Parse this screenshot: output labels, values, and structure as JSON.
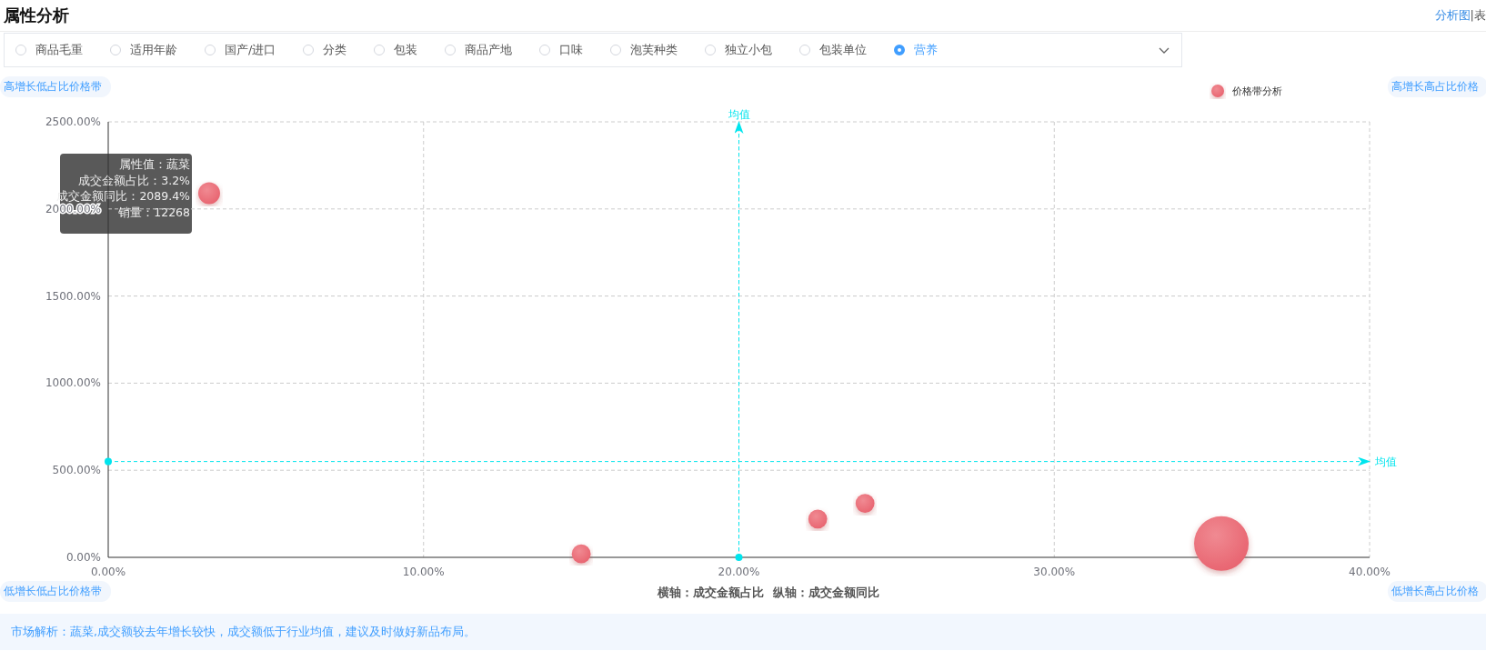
{
  "header": {
    "title": "属性分析",
    "view_links": [
      {
        "label": "分析图",
        "selected": true
      },
      {
        "label": "|表",
        "selected": false
      }
    ]
  },
  "attributes": [
    {
      "label": "商品毛重",
      "selected": false
    },
    {
      "label": "适用年龄",
      "selected": false
    },
    {
      "label": "国产/进口",
      "selected": false
    },
    {
      "label": "分类",
      "selected": false
    },
    {
      "label": "包装",
      "selected": false
    },
    {
      "label": "商品产地",
      "selected": false
    },
    {
      "label": "口味",
      "selected": false
    },
    {
      "label": "泡芙种类",
      "selected": false
    },
    {
      "label": "独立小包",
      "selected": false
    },
    {
      "label": "包装单位",
      "selected": false
    },
    {
      "label": "营养",
      "selected": true
    }
  ],
  "quadrants": {
    "top_left": "高增长低占比价格带",
    "top_right": "高增长高占比价格",
    "bottom_left": "低增长低占比价格带",
    "bottom_right": "低增长高占比价格"
  },
  "chart": {
    "chart_data": {
      "type": "scatter",
      "xlabel": "横轴：成交金额占比  纵轴：成交金额同比",
      "x": [
        3.2,
        15,
        22.5,
        24,
        35.3
      ],
      "series": [
        {
          "name": "价格带分析",
          "color": "#e8636f",
          "values": [
            2090,
            20,
            220,
            310,
            80
          ],
          "sizes": [
            0.16,
            0.12,
            0.12,
            0.12,
            1
          ]
        }
      ],
      "grid": true,
      "xlim": [
        0,
        40
      ],
      "ylim": [
        0,
        2500
      ],
      "xticks": [
        {
          "value": 0,
          "label": "0.00%"
        },
        {
          "value": 10,
          "label": "10.00%"
        },
        {
          "value": 20,
          "label": "20.00%"
        },
        {
          "value": 30,
          "label": "30.00%"
        },
        {
          "value": 40,
          "label": "40.00%"
        }
      ],
      "yticks": [
        {
          "value": 0,
          "label": "0.00%"
        },
        {
          "value": 500,
          "label": "500.00%"
        },
        {
          "value": 1000,
          "label": "1000.00%"
        },
        {
          "value": 1500,
          "label": "1500.00%"
        },
        {
          "value": 2000,
          "label": "2000.00%"
        },
        {
          "value": 2500,
          "label": "2500.00%"
        }
      ],
      "ref_lines": [
        {
          "axis": "x",
          "value": 20,
          "label": "均值"
        },
        {
          "axis": "y",
          "value": 550,
          "label": "均值"
        }
      ]
    },
    "tooltip": [
      "属性值：蔬菜",
      "成交金额占比：3.2%",
      "成交金额同比：2089.4%",
      "销量：12268"
    ]
  },
  "analysis": "市场解析：蔬菜,成交额较去年增长较快，成交额低于行业均值，建议及时做好新品布局。"
}
